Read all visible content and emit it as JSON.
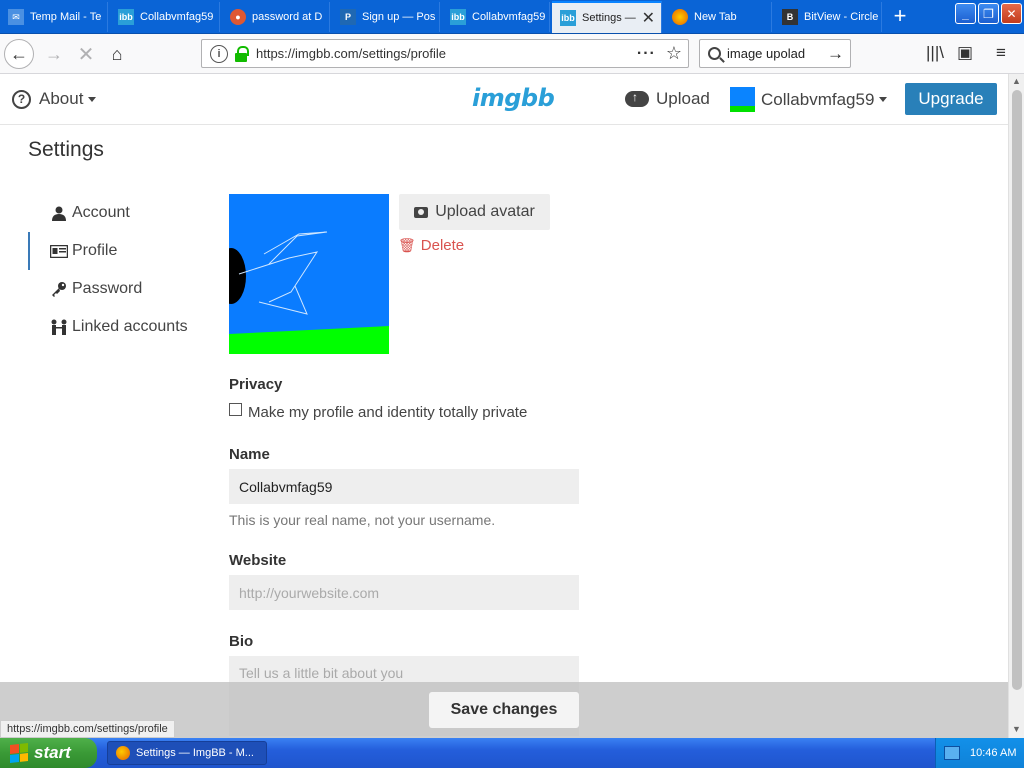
{
  "browser": {
    "tabs": [
      {
        "label": "Temp Mail - Te",
        "icon": "mail-icon",
        "color": "#4a90e2",
        "active": false
      },
      {
        "label": "Collabvmfag59",
        "icon": "imgbb-icon",
        "color": "#2a9fd8",
        "active": false
      },
      {
        "label": "password at D",
        "icon": "duckduckgo-icon",
        "color": "#de5833",
        "active": false
      },
      {
        "label": "Sign up — Pos",
        "icon": "postimages-icon",
        "color": "#1f68b3",
        "active": false
      },
      {
        "label": "Collabvmfag59",
        "icon": "imgbb-icon",
        "color": "#2a9fd8",
        "active": false
      },
      {
        "label": "Settings —",
        "icon": "imgbb-icon",
        "color": "#2a9fd8",
        "active": true
      },
      {
        "label": "New Tab",
        "icon": "firefox-icon",
        "color": "#e66000",
        "active": false
      },
      {
        "label": "BitView - Circle",
        "icon": "bitview-icon",
        "color": "#333333",
        "active": false
      }
    ],
    "url": "https://imgbb.com/settings/profile",
    "search_value": "image upolad",
    "status_url": "https://imgbb.com/settings/profile"
  },
  "site": {
    "about_label": "About",
    "logo": "imgbb",
    "upload_label": "Upload",
    "username": "Collabvmfag59",
    "upgrade_label": "Upgrade"
  },
  "settings": {
    "title": "Settings",
    "nav": [
      {
        "label": "Account",
        "icon": "user-icon",
        "active": false
      },
      {
        "label": "Profile",
        "icon": "id-card-icon",
        "active": true
      },
      {
        "label": "Password",
        "icon": "key-icon",
        "active": false
      },
      {
        "label": "Linked accounts",
        "icon": "linked-users-icon",
        "active": false
      }
    ],
    "upload_avatar_label": "Upload avatar",
    "delete_label": "Delete",
    "privacy_label": "Privacy",
    "privacy_checkbox_label": "Make my profile and identity totally private",
    "privacy_checked": false,
    "name_label": "Name",
    "name_value": "Collabvmfag59",
    "name_hint": "This is your real name, not your username.",
    "website_label": "Website",
    "website_placeholder": "http://yourwebsite.com",
    "bio_label": "Bio",
    "bio_placeholder": "Tell us a little bit about you",
    "save_label": "Save changes"
  },
  "taskbar": {
    "start_label": "start",
    "task_label": "Settings — ImgBB - M...",
    "clock": "10:46 AM"
  },
  "colors": {
    "accent": "#2980b9",
    "logo": "#2a9fd8",
    "danger": "#d9534f"
  }
}
